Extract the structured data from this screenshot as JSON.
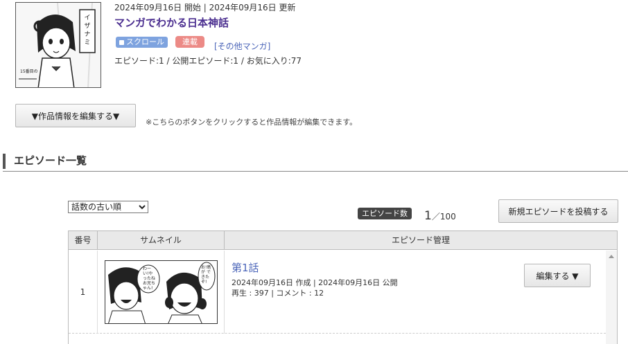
{
  "work": {
    "dates": "2024年09月16日 開始 | 2024年09月16日 更新",
    "title": "マンガでわかる日本神話",
    "format_badge": "スクロール",
    "status_badge": "連載",
    "genre": "[その他マンガ]",
    "stats": "エピソード:1 / 公開エピソード:1 / お気に入り:77",
    "thumbnail_text": "イザナミ",
    "thumbnail_caption": "15番目の"
  },
  "edit_info": {
    "button_label": "▼作品情報を編集する▼",
    "note": "※こちらのボタンをクリックすると作品情報が編集できます。"
  },
  "episodes_section": {
    "title": "エピソード一覧",
    "sort_selected": "話数の古い順",
    "count_label": "エピソード数",
    "count_value": "1",
    "count_max": "／100",
    "new_episode_button": "新規エピソードを投稿する"
  },
  "table": {
    "headers": [
      "番号",
      "サムネイル",
      "エピソード管理"
    ],
    "rows": [
      {
        "number": "1",
        "title": "第1話",
        "dates": "2024年09月16日 作成 | 2024年09月16日 公開",
        "stats": "再生 : 397 | コメント : 12",
        "edit_button": "編集する ▼",
        "thumbnail_bubble_left": "わーい!やったね お兄ちゃん!",
        "thumbnail_bubble_right": "お!島が できたぞ!"
      }
    ]
  },
  "colors": {
    "title_purple": "#4a2d8f",
    "link_blue": "#4a64b8",
    "scroll_badge": "#7ea3df",
    "serial_badge": "#ec8a86"
  }
}
